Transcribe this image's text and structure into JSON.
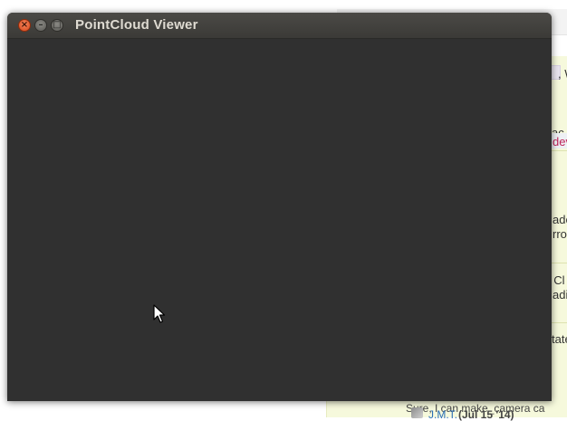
{
  "window": {
    "title": "PointCloud Viewer",
    "close_glyph": "×",
    "minimize_glyph": "–",
    "maximize_glyph": "□"
  },
  "background_page": {
    "lines": [
      {
        "id": "l1",
        "text": ", W",
        "link": false
      },
      {
        "id": "l2",
        "text": "ac",
        "link": false
      },
      {
        "id": "l3",
        "text": "dev",
        "link": true
      },
      {
        "id": "l4",
        "text": "ado",
        "link": false
      },
      {
        "id": "l5",
        "text": "rro",
        "link": false
      },
      {
        "id": "l6",
        "text": ": Cl",
        "link": false
      },
      {
        "id": "l7",
        "text": "adi",
        "link": false
      },
      {
        "id": "l8",
        "text": "tate",
        "link": false
      }
    ],
    "footer_text": "Sure, I can make_camera ca",
    "author": "J.M.T.",
    "author_date": "(Jul 15 '14)"
  },
  "colors": {
    "window_bg": "#303030",
    "titlebar": "#3f3e3b",
    "close_button": "#e9652e",
    "highlight_bg": "#f6f9dc"
  }
}
